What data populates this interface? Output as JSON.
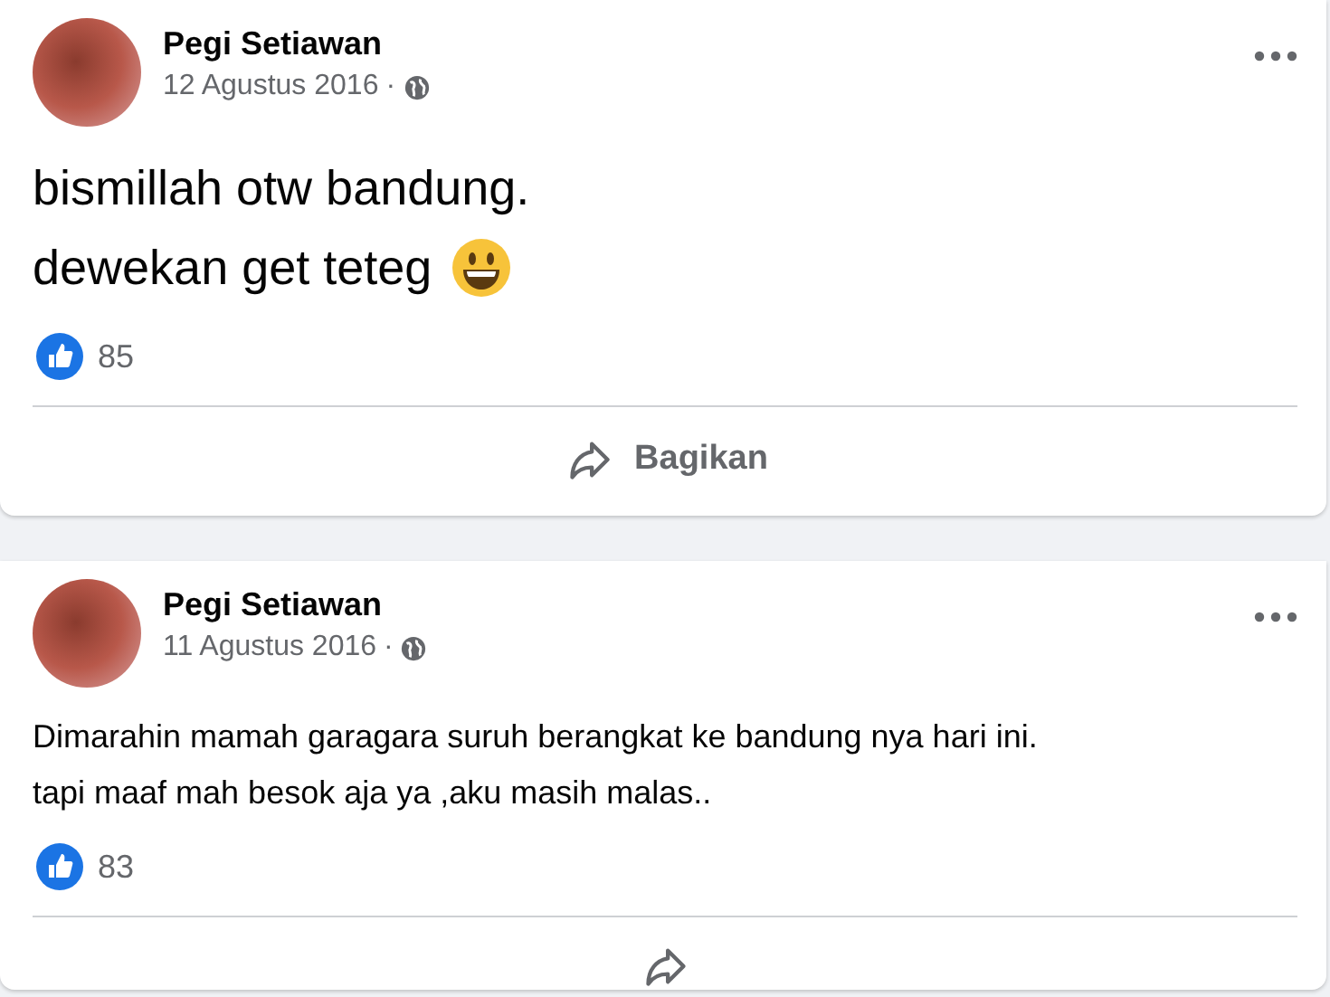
{
  "posts": [
    {
      "author": "Pegi Setiawan",
      "date": "12 Agustus 2016",
      "separator": "·",
      "kind": "large_text",
      "lines": [
        "bismillah otw bandung.",
        "dewekan get teteg"
      ],
      "trailing_emoji": true,
      "likes": "85",
      "share_label": "Bagikan"
    },
    {
      "author": "Pegi Setiawan",
      "date": "11 Agustus 2016",
      "separator": "·",
      "kind": "text",
      "lines": [
        "Dimarahin mamah garagara suruh berangkat ke bandung nya hari ini.",
        "tapi maaf mah besok aja ya ,aku masih malas.."
      ],
      "trailing_emoji": false,
      "likes": "83"
    }
  ]
}
